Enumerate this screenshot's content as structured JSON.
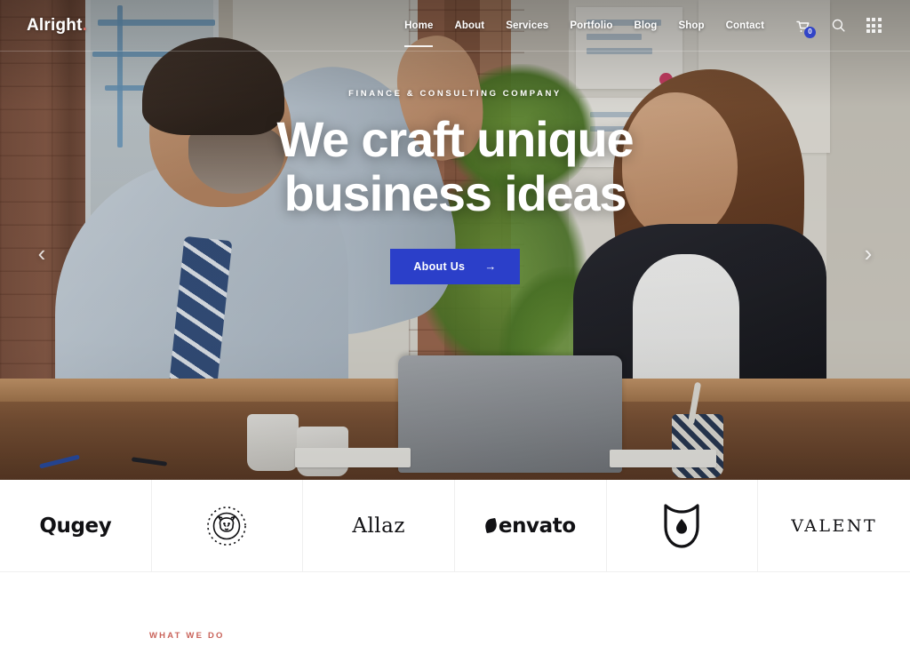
{
  "header": {
    "brand": "Alright",
    "brand_dot": ".",
    "nav": [
      {
        "label": "Home",
        "active": true
      },
      {
        "label": "About",
        "active": false
      },
      {
        "label": "Services",
        "active": false
      },
      {
        "label": "Portfolio",
        "active": false
      },
      {
        "label": "Blog",
        "active": false
      },
      {
        "label": "Shop",
        "active": false
      },
      {
        "label": "Contact",
        "active": false
      }
    ],
    "actions": {
      "cart_icon": "shopping-cart-icon",
      "cart_count": "0",
      "search_icon": "search-icon",
      "apps_icon": "grid-apps-icon"
    }
  },
  "hero": {
    "eyebrow": "FINANCE & CONSULTING COMPANY",
    "headline_line1": "We craft unique",
    "headline_line2": "business ideas",
    "cta_label": "About Us",
    "cta_arrow": "→",
    "prev_arrow": "‹",
    "next_arrow": "›",
    "accent_color": "#2b3fc9"
  },
  "logos": [
    {
      "name": "Qugey",
      "type": "text"
    },
    {
      "name": "Bulldog Badge",
      "type": "mark"
    },
    {
      "name": "Allaz",
      "type": "text-serif"
    },
    {
      "name": "envato",
      "type": "text-leaf"
    },
    {
      "name": "Tulip Shield",
      "type": "mark"
    },
    {
      "name": "VALENT",
      "type": "text-valent"
    }
  ],
  "section": {
    "kicker": "WHAT WE DO",
    "kicker_color": "#c9635a"
  }
}
